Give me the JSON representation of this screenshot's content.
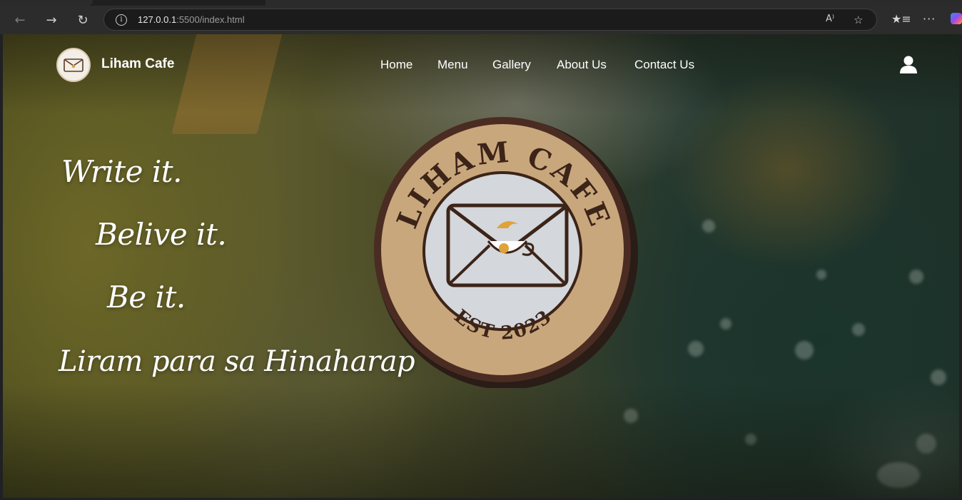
{
  "browser": {
    "url_host": "127.0.0.1",
    "url_rest": ":5500/index.html"
  },
  "site": {
    "brand": "Liham Cafe",
    "nav": [
      "Home",
      "Menu",
      "Gallery",
      "About Us",
      "Contact Us"
    ],
    "icons": {
      "logo": "envelope-coffee-logo",
      "account": "user-icon"
    }
  },
  "hero": {
    "lines": [
      "Write it.",
      "Belive it.",
      "Be it.",
      "Liram para sa Hinaharap"
    ]
  },
  "sign": {
    "name": "LIHAM CAFE",
    "est": "EST 2023"
  },
  "colors": {
    "sign_ring": "#c9a77c",
    "sign_center": "#d4d7dc",
    "sign_text": "#3c2418",
    "cup_accent": "#e0a23a"
  }
}
